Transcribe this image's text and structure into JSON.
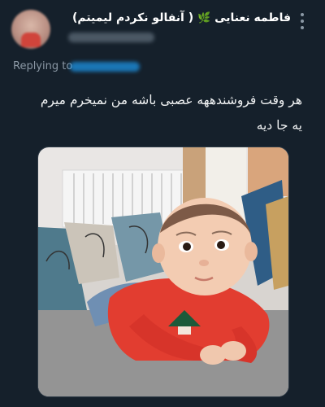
{
  "tweet": {
    "display_name": "فاطمه نعنایی",
    "name_suffix": "( آنفالو نکردم لیمیتم)",
    "leaf_icon": "seedling-icon",
    "more_icon": "more-vertical-icon",
    "replying_label": "Replying to",
    "text_line1": "هر وقت فروشندههه عصبی باشه من نمیخرم میرم",
    "text_line2": "یه جا دیه",
    "media_description": "baby-lying-on-rug-photo"
  },
  "colors": {
    "background": "#15202b",
    "text": "#e7e9ea",
    "secondary": "#8b98a5",
    "accent": "#1d9bf0"
  }
}
